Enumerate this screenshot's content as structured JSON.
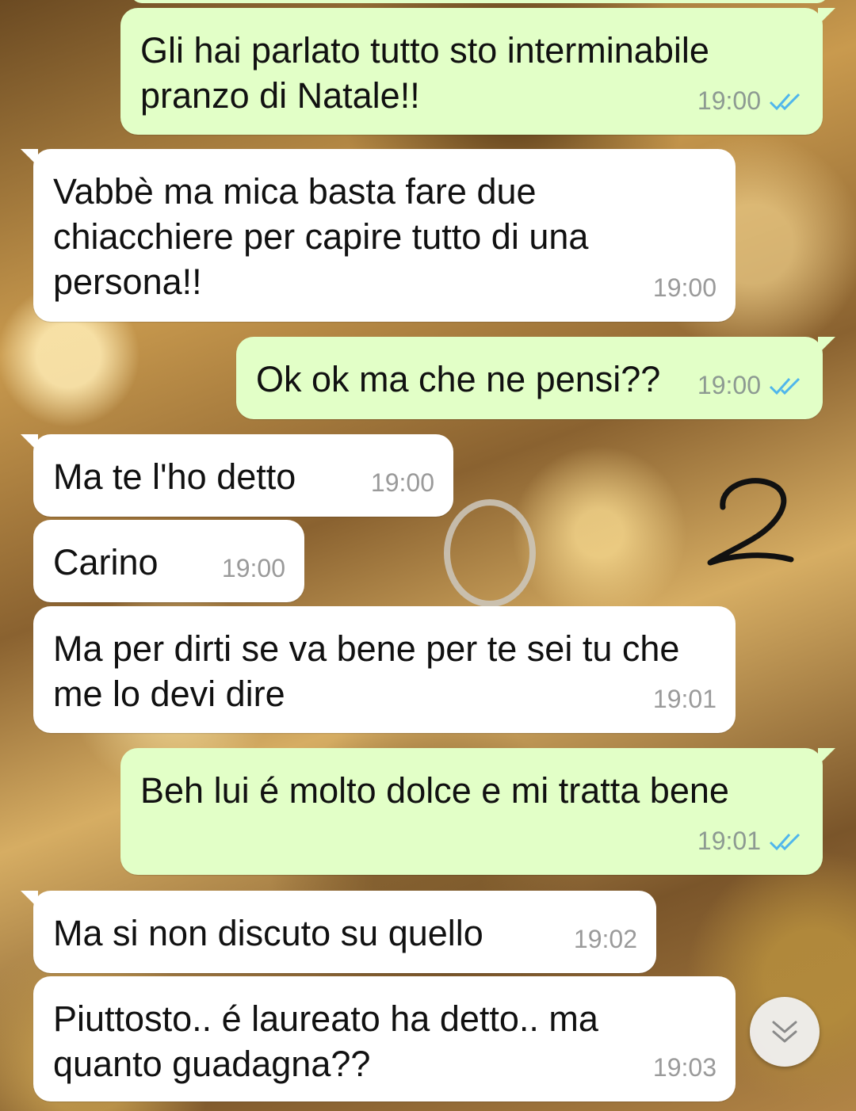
{
  "messages": [
    {
      "text": "Gli hai parlato tutto sto interminabile\npranzo di Natale!!",
      "time": "19:00",
      "direction": "outgoing",
      "status": "read"
    },
    {
      "text": "Vabbè ma mica basta fare due\nchiacchiere per capire tutto di una\npersona!!",
      "time": "19:00",
      "direction": "incoming"
    },
    {
      "text": "Ok ok ma che ne pensi??",
      "time": "19:00",
      "direction": "outgoing",
      "status": "read"
    },
    {
      "text": "Ma te l'ho detto",
      "time": "19:00",
      "direction": "incoming"
    },
    {
      "text": "Carino",
      "time": "19:00",
      "direction": "incoming"
    },
    {
      "text": "Ma per dirti se va bene per te sei tu che\nme lo devi dire",
      "time": "19:01",
      "direction": "incoming"
    },
    {
      "text": "Beh lui é molto dolce e mi tratta bene",
      "time": "19:01",
      "direction": "outgoing",
      "status": "read"
    },
    {
      "text": "Ma si non discuto su quello",
      "time": "19:02",
      "direction": "incoming"
    },
    {
      "text": "Piuttosto.. é laureato ha detto.. ma\nquanto guadagna??",
      "time": "19:03",
      "direction": "incoming"
    }
  ],
  "annotation": "2",
  "icons": {
    "read_receipt": "double-check-icon",
    "scroll_down": "chevron-double-down-icon"
  },
  "colors": {
    "outgoing_bubble": "#e2ffc7",
    "incoming_bubble": "#ffffff",
    "read_tick": "#4fb6ec",
    "timestamp": "#8d9a92"
  }
}
